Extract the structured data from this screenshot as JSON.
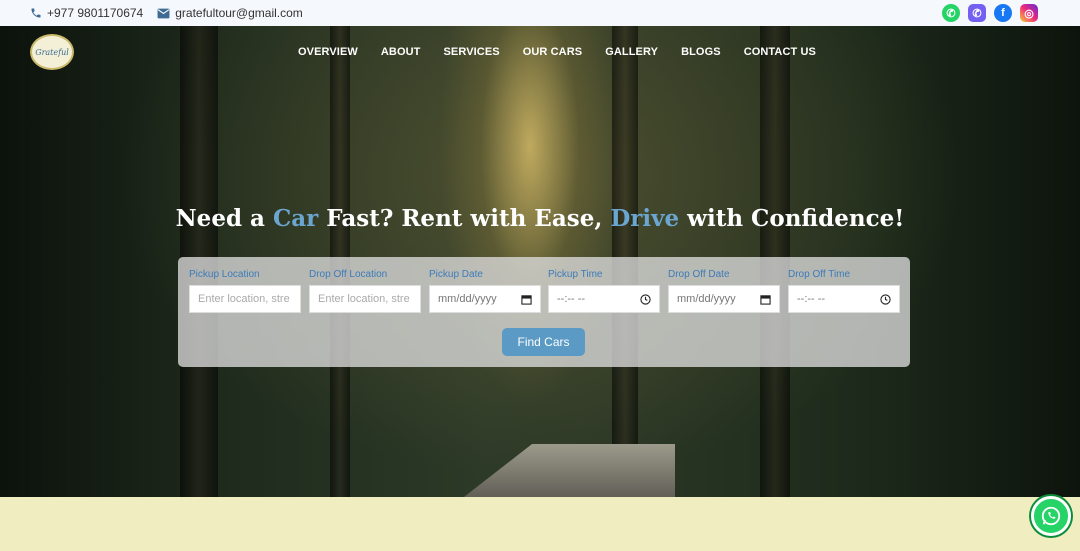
{
  "topbar": {
    "phone": "+977 9801170674",
    "email": "gratefultour@gmail.com",
    "socials": [
      {
        "icon": "whatsapp-icon"
      },
      {
        "icon": "viber-icon"
      },
      {
        "icon": "facebook-icon"
      },
      {
        "icon": "instagram-icon"
      }
    ]
  },
  "nav": {
    "items": [
      "OVERVIEW",
      "ABOUT",
      "SERVICES",
      "OUR CARS",
      "GALLERY",
      "BLOGS",
      "CONTACT US"
    ]
  },
  "hero": {
    "headline_part1": "Need a ",
    "headline_hl1": "Car",
    "headline_part2": " Fast? Rent with Ease, ",
    "headline_hl2": "Drive",
    "headline_part3": " with Confidence!",
    "accent_color": "#6aa6cf"
  },
  "form": {
    "fields": [
      {
        "label": "Pickup Location",
        "placeholder": "Enter location, stre"
      },
      {
        "label": "Drop Off Location",
        "placeholder": "Enter location, stre"
      },
      {
        "label": "Pickup Date",
        "value": "mm/dd/yyyy"
      },
      {
        "label": "Pickup Time",
        "value": "--:-- --"
      },
      {
        "label": "Drop Off Date",
        "value": "mm/dd/yyyy"
      },
      {
        "label": "Drop Off Time",
        "value": "--:-- --"
      }
    ],
    "submit_label": "Find Cars"
  },
  "colors": {
    "button": "#5b9ac4",
    "label": "#3d7bb8",
    "footer_band": "#f0eec0"
  }
}
